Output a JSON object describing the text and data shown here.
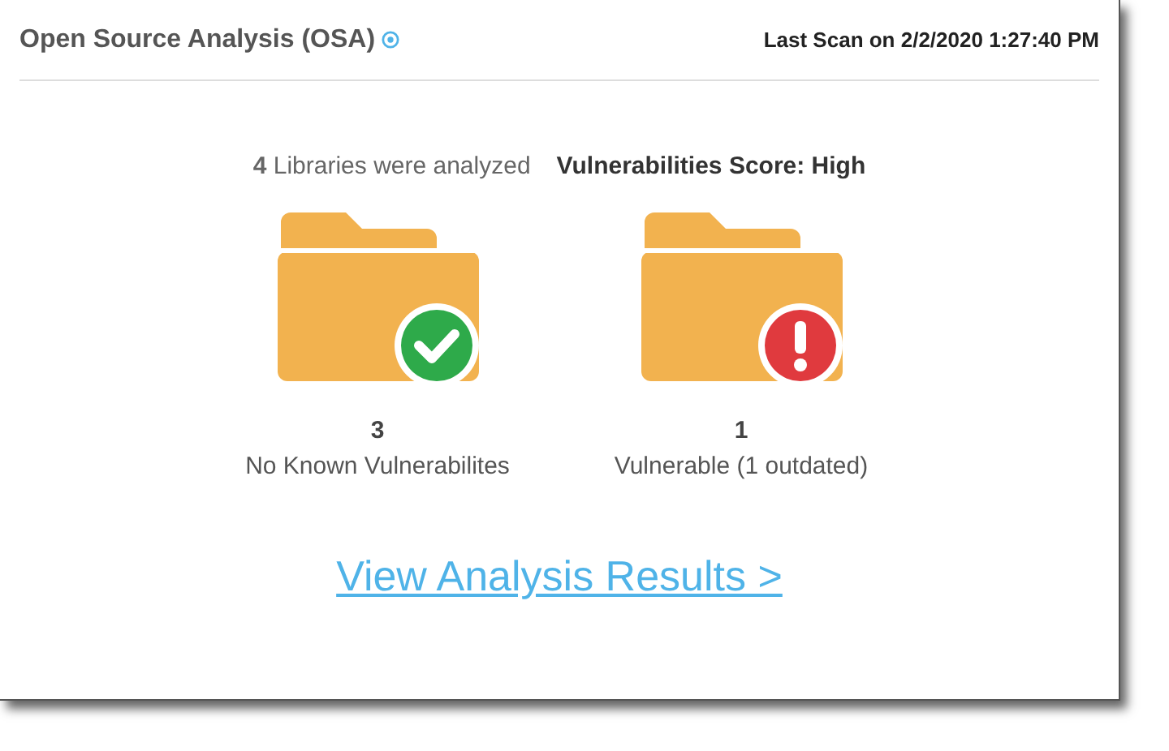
{
  "header": {
    "title": "Open Source Analysis (OSA)",
    "last_scan": "Last Scan on 2/2/2020 1:27:40 PM"
  },
  "summary": {
    "libraries": "**4** Libraries were analyzed",
    "score": "Vulnerabilities Score: High"
  },
  "groups": [
    {
      "kind": "ok",
      "count": "3",
      "label": "No Known Vulnerabilites"
    },
    {
      "kind": "vulnerable",
      "count": "1",
      "label": "Vulnerable (1 outdated)"
    }
  ],
  "link": "View Analysis Results >"
}
